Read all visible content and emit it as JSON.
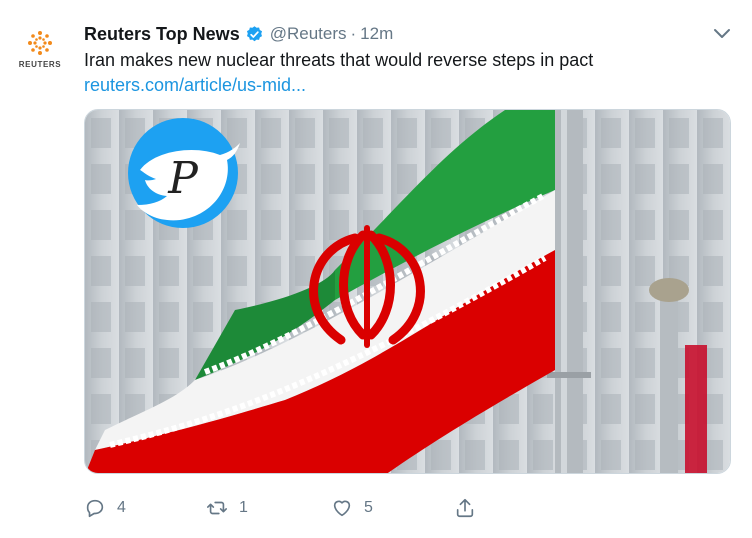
{
  "author": {
    "display_name": "Reuters Top News",
    "handle": "@Reuters",
    "separator": "·",
    "time": "12m",
    "avatar_wordmark": "REUTERS",
    "verified_icon": "verified-badge-icon"
  },
  "tweet": {
    "text": "Iran makes new nuclear threats that would reverse steps in pact",
    "link": "reuters.com/article/us-mid..."
  },
  "media": {
    "watermark_letter": "P",
    "colors": {
      "flag_green": "#239f40",
      "flag_white": "#f4f4f4",
      "flag_red": "#da0000",
      "watermark_blue": "#1da1f2"
    }
  },
  "actions": {
    "reply_count": "4",
    "retweet_count": "1",
    "like_count": "5",
    "icons": [
      "reply-icon",
      "retweet-icon",
      "like-icon",
      "share-icon"
    ]
  },
  "colors": {
    "text": "#14171a",
    "secondary": "#657786",
    "link": "#1b95e0",
    "verified": "#1da1f2"
  }
}
